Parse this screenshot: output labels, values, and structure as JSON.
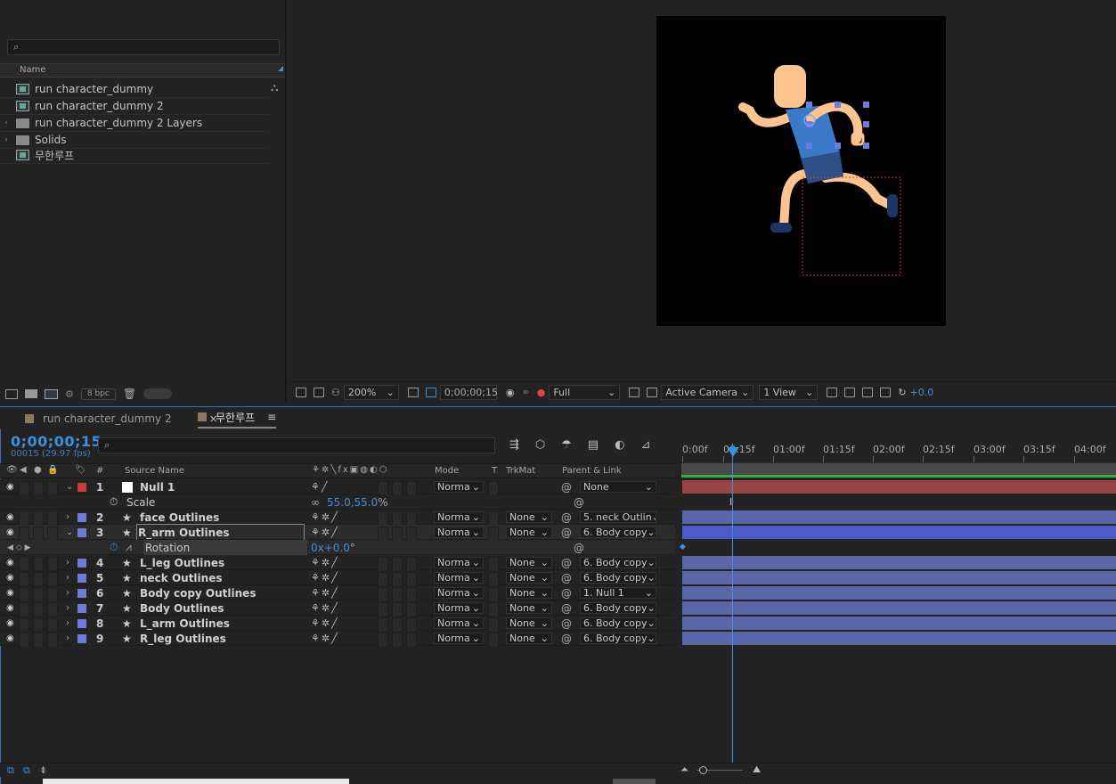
{
  "project": {
    "search_placeholder": "",
    "column_name": "Name",
    "items": [
      {
        "label": "run character_dummy",
        "kind": "comp"
      },
      {
        "label": "run character_dummy 2",
        "kind": "comp"
      },
      {
        "label": "run character_dummy 2 Layers",
        "kind": "folder"
      },
      {
        "label": "Solids",
        "kind": "folder"
      },
      {
        "label": "무한루프",
        "kind": "comp"
      }
    ],
    "bpc": "8 bpc"
  },
  "viewer": {
    "zoom": "200%",
    "timecode": "0;00;00;15",
    "resolution": "Full",
    "camera": "Active Camera",
    "views": "1 View",
    "exposure": "+0.0"
  },
  "tabs": [
    {
      "label": "run character_dummy 2",
      "active": false
    },
    {
      "label": "무한루프",
      "active": true
    }
  ],
  "timeline": {
    "current_time": "0;00;00;15",
    "frame_info": "00015 (29.97 fps)",
    "columns": {
      "num": "#",
      "source": "Source Name",
      "mode": "Mode",
      "t": "T",
      "trkmat": "TrkMat",
      "parent": "Parent & Link"
    },
    "ruler": [
      "0:00f",
      "00:15f",
      "01:00f",
      "01:15f",
      "02:00f",
      "02:15f",
      "03:00f",
      "03:15f",
      "04:00f"
    ],
    "layers": [
      {
        "num": "1",
        "name": "Null 1",
        "color": "#c8403c",
        "mode": "Norma",
        "trkmat": "",
        "parent": "None",
        "null": true
      },
      {
        "prop": "Scale",
        "value": "55.0,55.0",
        "unit": "%"
      },
      {
        "num": "2",
        "name": "face Outlines",
        "color": "#6a7ed8",
        "mode": "Norma",
        "trkmat": "None",
        "parent": "5. neck Outlin"
      },
      {
        "num": "3",
        "name": "R_arm Outlines",
        "color": "#6a7ed8",
        "mode": "Norma",
        "trkmat": "None",
        "parent": "6. Body copy",
        "selected": true
      },
      {
        "prop": "Rotation",
        "value": "0x+0.0",
        "unit": "°"
      },
      {
        "num": "4",
        "name": "L_leg Outlines",
        "color": "#6a7ed8",
        "mode": "Norma",
        "trkmat": "None",
        "parent": "6. Body copy"
      },
      {
        "num": "5",
        "name": "neck Outlines",
        "color": "#6a7ed8",
        "mode": "Norma",
        "trkmat": "None",
        "parent": "6. Body copy"
      },
      {
        "num": "6",
        "name": "Body copy Outlines",
        "color": "#6a7ed8",
        "mode": "Norma",
        "trkmat": "None",
        "parent": "1. Null 1"
      },
      {
        "num": "7",
        "name": "Body Outlines",
        "color": "#6a7ed8",
        "mode": "Norma",
        "trkmat": "None",
        "parent": "6. Body copy"
      },
      {
        "num": "8",
        "name": "L_arm Outlines",
        "color": "#6a7ed8",
        "mode": "Norma",
        "trkmat": "None",
        "parent": "6. Body copy"
      },
      {
        "num": "9",
        "name": "R_leg Outlines",
        "color": "#6a7ed8",
        "mode": "Norma",
        "trkmat": "None",
        "parent": "6. Body copy"
      }
    ]
  },
  "colors": {
    "accent": "#3d8fe0",
    "null_track": "#9a4646",
    "layer_track": "#5a66a8",
    "skin": "#fdc48f",
    "shirt": "#3a78c8",
    "shorts": "#2d4f86"
  }
}
